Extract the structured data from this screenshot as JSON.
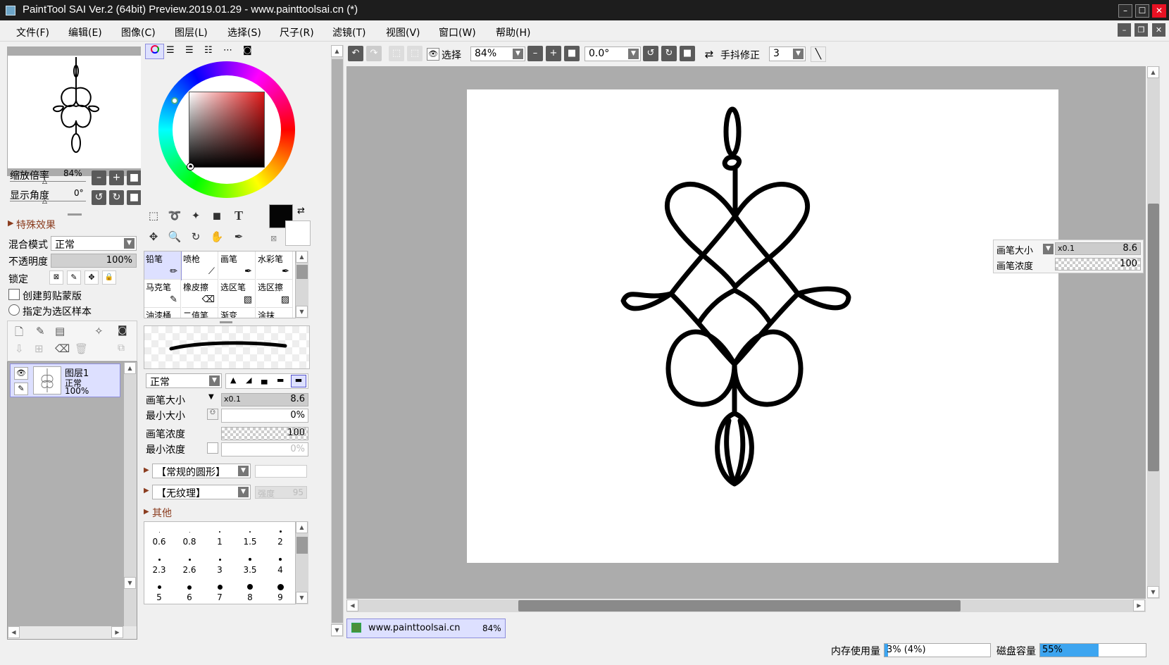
{
  "window": {
    "title": "PaintTool SAI Ver.2 (64bit) Preview.2019.01.29 - www.painttoolsai.cn (*)",
    "minimize": "–",
    "maximize": "☐",
    "close": "✕"
  },
  "menu": [
    "文件(F)",
    "编辑(E)",
    "图像(C)",
    "图层(L)",
    "选择(S)",
    "尺子(R)",
    "滤镜(T)",
    "视图(V)",
    "窗口(W)",
    "帮助(H)"
  ],
  "navigator": {
    "zoom_label": "缩放倍率",
    "zoom_value": "84%",
    "angle_label": "显示角度",
    "angle_value": "0°"
  },
  "layer_props": {
    "effects_label": "特殊效果",
    "blend_label": "混合模式",
    "blend_value": "正常",
    "opacity_label": "不透明度",
    "opacity_value": "100%",
    "opacity_fraction": 1.0,
    "lock_label": "锁定",
    "clip_label": "创建剪贴蒙版",
    "sample_label": "指定为选区样本"
  },
  "layers": [
    {
      "name": "图层1",
      "mode": "正常",
      "opacity": "100%"
    }
  ],
  "tools": {
    "brushes": [
      {
        "name": "铅笔",
        "icon": "pencil-icon"
      },
      {
        "name": "喷枪",
        "icon": "airbrush-icon"
      },
      {
        "name": "画笔",
        "icon": "brush-icon"
      },
      {
        "name": "水彩笔",
        "icon": "watercolor-icon"
      },
      {
        "name": "马克笔",
        "icon": "marker-icon"
      },
      {
        "name": "橡皮擦",
        "icon": "eraser-icon"
      },
      {
        "name": "选区笔",
        "icon": "selpen-icon"
      },
      {
        "name": "选区擦",
        "icon": "selerase-icon"
      },
      {
        "name": "油漆桶",
        "icon": "bucket-icon"
      },
      {
        "name": "二值笔",
        "icon": "binary-icon"
      },
      {
        "name": "渐变",
        "icon": "gradient-icon"
      },
      {
        "name": "涂抹",
        "icon": "smudge-icon"
      }
    ],
    "blend_mode": "正常",
    "size_label": "画笔大小",
    "size_mult": "x0.1",
    "size_value": "8.6",
    "min_size_label": "最小大小",
    "min_size_value": "0%",
    "density_label": "画笔浓度",
    "density_value": "100",
    "min_density_label": "最小浓度",
    "min_density_value": "0%",
    "shape": "【常规的圆形】",
    "texture": "【无纹理】",
    "strength_label": "强度",
    "strength_value": "95",
    "other_label": "其他",
    "dot_sizes": [
      "0.6",
      "0.8",
      "1",
      "1.5",
      "2",
      "2.3",
      "2.6",
      "3",
      "3.5",
      "4",
      "5",
      "6",
      "7",
      "8",
      "9"
    ]
  },
  "toolbar": {
    "select_label": "选择",
    "zoom": "84%",
    "angle": "0.0°",
    "stabilizer_label": "手抖修正",
    "stabilizer_value": "3"
  },
  "canvas_popup": {
    "size_label": "画笔大小",
    "size_mult": "x0.1",
    "size_value": "8.6",
    "density_label": "画笔浓度",
    "density_value": "100"
  },
  "doc_tab": {
    "name": "www.painttoolsai.cn",
    "zoom": "84%"
  },
  "status": {
    "memory_label": "内存使用量",
    "memory_value": "3% (4%)",
    "memory_fraction": 0.03,
    "disk_label": "磁盘容量",
    "disk_value": "55%",
    "disk_fraction": 0.55
  },
  "colors": {
    "accent": "#3da5f0",
    "selected": "#dde0ff",
    "dark_btn": "#5a5a5a"
  }
}
